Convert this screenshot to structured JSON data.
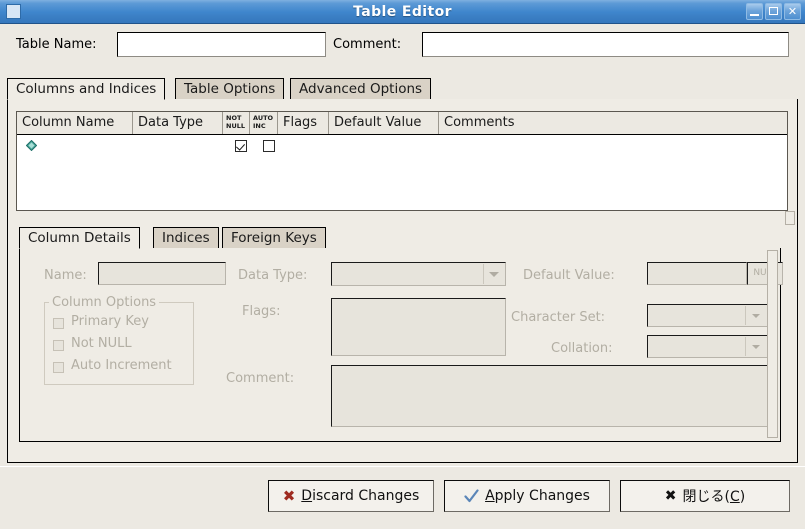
{
  "window": {
    "title": "Table Editor",
    "app_icon": "window-icon",
    "controls": {
      "minimize": "minimize-icon",
      "maximize": "maximize-icon",
      "close": "close-icon"
    }
  },
  "header": {
    "table_name_label": "Table Name:",
    "table_name_value": "",
    "comment_label": "Comment:",
    "comment_value": ""
  },
  "main_tabs": {
    "selected": "Columns and Indices",
    "items": [
      {
        "label": "Columns and Indices",
        "selected": true
      },
      {
        "label": "Table Options",
        "selected": false
      },
      {
        "label": "Advanced Options",
        "selected": false
      }
    ]
  },
  "grid": {
    "columns": [
      {
        "label": "Column Name",
        "tiny": false
      },
      {
        "label": "Data Type",
        "tiny": false
      },
      {
        "label": "NOT NULL",
        "tiny": true,
        "line1": "NOT",
        "line2": "NULL"
      },
      {
        "label": "AUTO INC",
        "tiny": true,
        "line1": "AUTO",
        "line2": "INC"
      },
      {
        "label": "Flags",
        "tiny": false
      },
      {
        "label": "Default Value",
        "tiny": false
      },
      {
        "label": "Comments",
        "tiny": false
      }
    ],
    "rows": [
      {
        "icon": "diamond-icon",
        "column_name": "",
        "data_type": "",
        "not_null": true,
        "auto_inc": false,
        "flags": "",
        "default_value": "",
        "comments": ""
      }
    ]
  },
  "detail_tabs": {
    "selected": "Column Details",
    "items": [
      {
        "label": "Column Details",
        "selected": true
      },
      {
        "label": "Indices",
        "selected": false
      },
      {
        "label": "Foreign Keys",
        "selected": false
      }
    ]
  },
  "column_details": {
    "name_label": "Name:",
    "name_value": "",
    "data_type_label": "Data Type:",
    "data_type_value": "",
    "default_value_label": "Default Value:",
    "default_value_value": "",
    "null_button_label": "NULL",
    "column_options_title": "Column Options",
    "column_options": [
      {
        "label": "Primary Key",
        "checked": false
      },
      {
        "label": "Not NULL",
        "checked": false
      },
      {
        "label": "Auto Increment",
        "checked": false
      }
    ],
    "flags_label": "Flags:",
    "flags_value": "",
    "character_set_label": "Character Set:",
    "character_set_value": "",
    "collation_label": "Collation:",
    "collation_value": "",
    "comment_label": "Comment:",
    "comment_value": "",
    "enabled": false
  },
  "buttons": {
    "discard": {
      "label": "Discard Changes",
      "mnemonic": "D",
      "icon": "x-red-icon"
    },
    "apply": {
      "label": "Apply Changes",
      "mnemonic": "A",
      "icon": "check-blue-icon"
    },
    "close": {
      "label": "閉じる(C)",
      "mnemonic": "C",
      "icon": "x-black-icon"
    }
  },
  "colors": {
    "titlebar_blue": "#3f86cd",
    "window_bg": "#ece9e2",
    "panel_bg": "#efece5",
    "tab_unselected": "#d9d2c6",
    "disabled_text": "#b2aea3",
    "diamond_teal": "#4aa89c",
    "x_red": "#9e2b20",
    "check_blue": "#5b86b8"
  }
}
